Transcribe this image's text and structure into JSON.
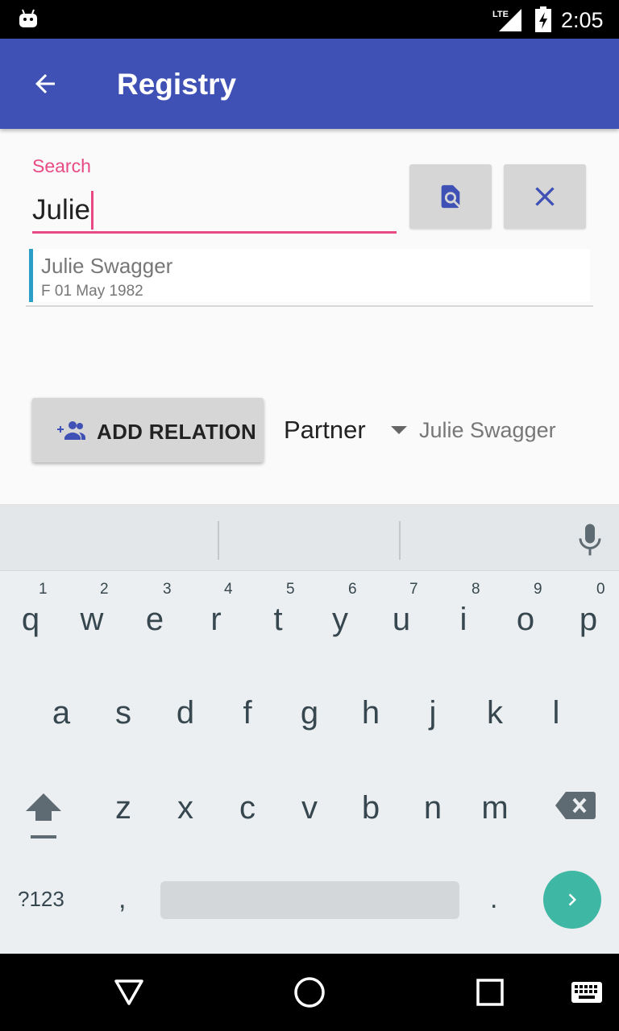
{
  "status_bar": {
    "network": "LTE",
    "time": "2:05"
  },
  "app_bar": {
    "title": "Registry"
  },
  "search": {
    "label": "Search",
    "value": "Julie"
  },
  "results": [
    {
      "name": "Julie  Swagger",
      "gender": "F",
      "dob": "01 May 1982",
      "meta": "F  01 May 1982"
    }
  ],
  "relation": {
    "button_label": "ADD RELATION",
    "type": "Partner",
    "person": "Julie  Swagger"
  },
  "keyboard": {
    "row1": [
      {
        "letter": "q",
        "num": "1"
      },
      {
        "letter": "w",
        "num": "2"
      },
      {
        "letter": "e",
        "num": "3"
      },
      {
        "letter": "r",
        "num": "4"
      },
      {
        "letter": "t",
        "num": "5"
      },
      {
        "letter": "y",
        "num": "6"
      },
      {
        "letter": "u",
        "num": "7"
      },
      {
        "letter": "i",
        "num": "8"
      },
      {
        "letter": "o",
        "num": "9"
      },
      {
        "letter": "p",
        "num": "0"
      }
    ],
    "row2": [
      "a",
      "s",
      "d",
      "f",
      "g",
      "h",
      "j",
      "k",
      "l"
    ],
    "row3": [
      "z",
      "x",
      "c",
      "v",
      "b",
      "n",
      "m"
    ],
    "symbols_label": "?123",
    "comma": ",",
    "period": "."
  },
  "colors": {
    "primary": "#3f51b5",
    "accent": "#e84a85",
    "result_marker": "#2aa0c8",
    "enter_key": "#3fb7a5"
  },
  "icons": {
    "back": "arrow-left-icon",
    "search": "find-in-page-icon",
    "clear": "close-icon",
    "add_relation": "group-add-icon",
    "mic": "mic-icon",
    "shift": "shift-icon",
    "backspace": "backspace-icon",
    "enter": "chevron-right-icon"
  }
}
